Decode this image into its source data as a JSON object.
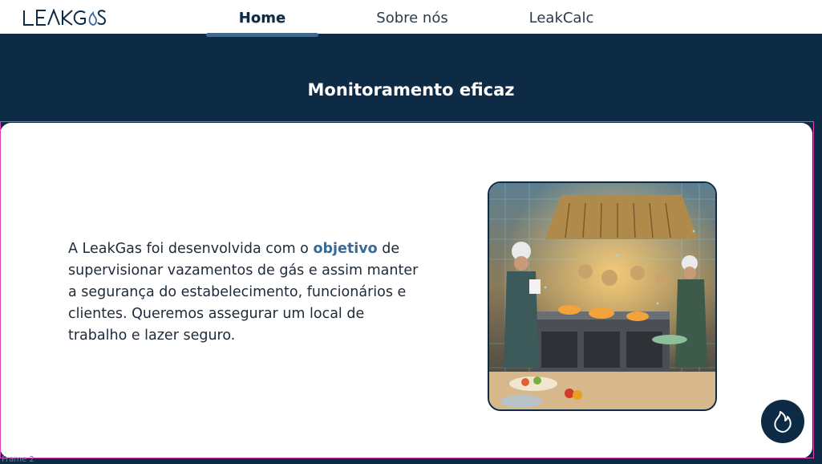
{
  "brand": {
    "logo_text": "LEAKGAS"
  },
  "nav": {
    "items": [
      {
        "label": "Home",
        "active": true
      },
      {
        "label": "Sobre nós",
        "active": false
      },
      {
        "label": "LeakCalc",
        "active": false
      }
    ]
  },
  "hero": {
    "title": "Monitoramento eficaz"
  },
  "about": {
    "text_before": "A LeakGas foi desenvolvida com o ",
    "highlight": "objetivo",
    "text_after": " de supervisionar vazamentos de gás e assim manter a segurança do estabelecimento, funcionários e clientes. Queremos assegurar um local de trabalho e lazer seguro."
  },
  "image": {
    "description": "chef-kitchen-monitoring-illustration"
  },
  "fab": {
    "icon": "flame-icon"
  },
  "frame_label": "Frame 2",
  "colors": {
    "primary": "#0d2b45",
    "accent": "#3a6a96",
    "background": "#ffffff"
  }
}
